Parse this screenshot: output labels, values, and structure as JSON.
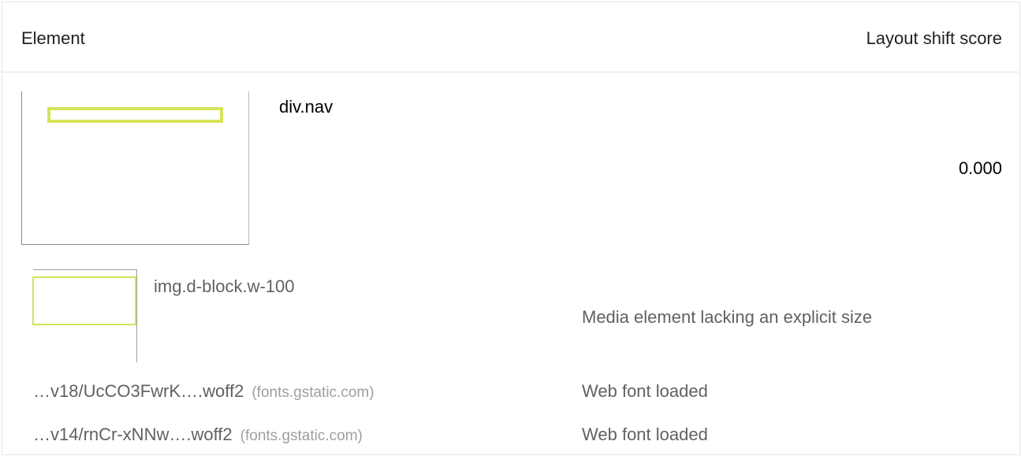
{
  "table": {
    "headers": {
      "element": "Element",
      "score": "Layout shift score"
    },
    "main_row": {
      "element_label": "div.nav",
      "score": "0.000"
    },
    "sub_rows": [
      {
        "element_label": "img.d-block.w-100",
        "reason": "Media element lacking an explicit size"
      }
    ],
    "font_rows": [
      {
        "file": "…v18/UcCO3FwrK….woff2",
        "host": "(fonts.gstatic.com)",
        "reason": "Web font loaded"
      },
      {
        "file": "…v14/rnCr-xNNw….woff2",
        "host": "(fonts.gstatic.com)",
        "reason": "Web font loaded"
      }
    ]
  },
  "colors": {
    "highlight": "#d5e45a",
    "border": "#e4e4e4",
    "primary_text": "#212121",
    "secondary_text": "#616161",
    "muted_text": "#9e9e9e"
  }
}
